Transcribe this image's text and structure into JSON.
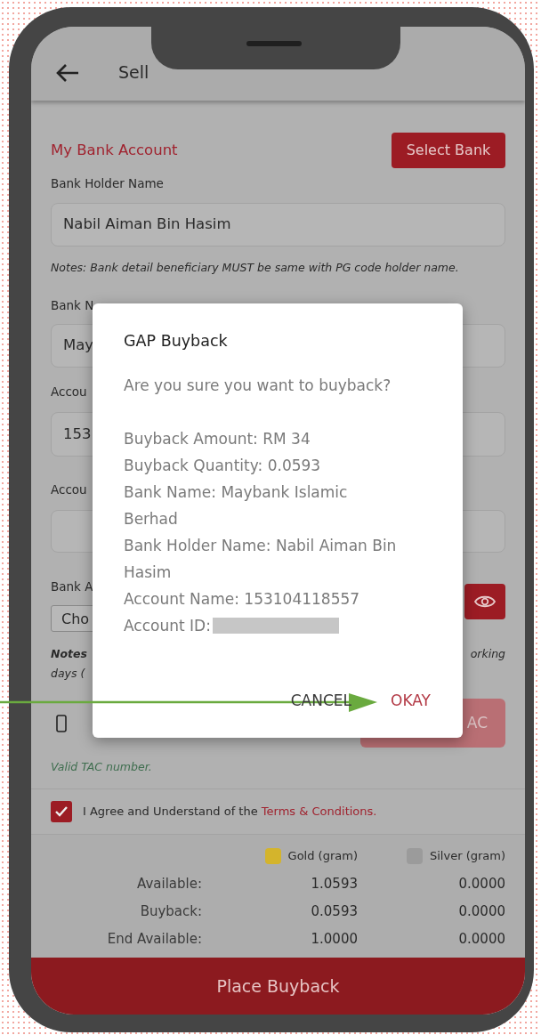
{
  "header": {
    "title": "Sell"
  },
  "bank_section": {
    "title": "My Bank Account",
    "select_button": "Select Bank",
    "holder_label": "Bank Holder Name",
    "holder_value": "Nabil Aiman Bin Hasim",
    "note": "Notes: Bank detail beneficiary MUST be same with PG code holder name."
  },
  "partial_fields": [
    {
      "label": "Bank N",
      "value": "May"
    },
    {
      "label": "Accou",
      "value": "153"
    },
    {
      "label": "Accou"
    }
  ],
  "bank_account": {
    "label": "Bank A",
    "select_value": "Cho"
  },
  "partial_notes": {
    "start": "Notes",
    "end": "orking",
    "line_2": "days ("
  },
  "tac": {
    "button": "AC",
    "status": "Valid TAC number."
  },
  "agreement": {
    "checked": true,
    "text": "I Agree and Understand of the ",
    "link": "Terms & Conditions."
  },
  "summary": {
    "columns": [
      {
        "label": "Gold (gram)",
        "color": "#d4b42c"
      },
      {
        "label": "Silver (gram)",
        "color": "#9b9b9b"
      }
    ],
    "rows": [
      {
        "label": "Available:",
        "values": [
          "1.0593",
          "0.0000"
        ]
      },
      {
        "label": "Buyback:",
        "values": [
          "0.0593",
          "0.0000"
        ]
      },
      {
        "label": "End Available:",
        "values": [
          "1.0000",
          "0.0000"
        ]
      }
    ]
  },
  "primary_button": "Place Buyback",
  "dialog": {
    "title": "GAP Buyback",
    "question": "Are you sure you want to buyback?",
    "details": [
      "Buyback Amount: RM 34",
      "Buyback Quantity: 0.0593",
      "Bank Name: Maybank Islamic Berhad",
      "Bank Holder Name: Nabil Aiman Bin Hasim",
      "Account Name: 153104118557",
      "Account ID:"
    ],
    "buttons": [
      {
        "label": "CANCEL",
        "kind": "cancel"
      },
      {
        "label": "OKAY",
        "kind": "confirm"
      }
    ]
  }
}
